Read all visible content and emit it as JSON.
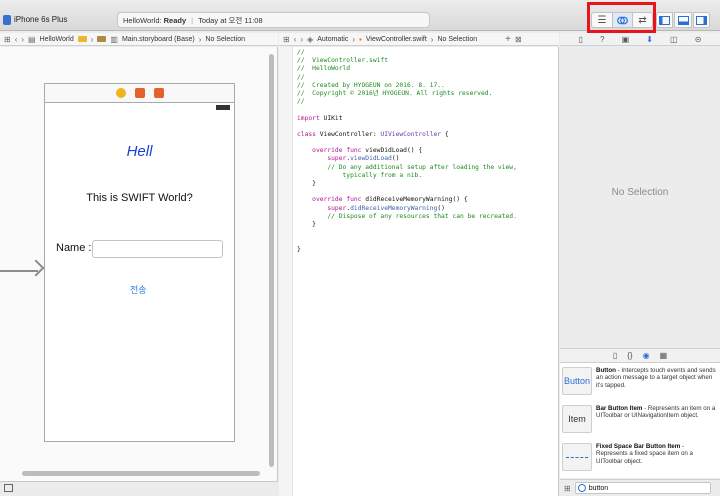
{
  "toolbar": {
    "scheme_device": "iPhone 6s Plus",
    "activity_project": "HelloWorld:",
    "activity_status": "Ready",
    "activity_time": "Today at 오전 11:08"
  },
  "ib_jumpbar": {
    "project": "HelloWorld",
    "file": "Main.storyboard (Base)",
    "selection": "No Selection"
  },
  "code_jumpbar": {
    "mode": "Automatic",
    "file": "ViewController.swift",
    "selection": "No Selection"
  },
  "scene": {
    "hell_label": "Hell",
    "title_label": "This is SWIFT World?",
    "name_label": "Name :",
    "send_button": "전송"
  },
  "code": {
    "lines": [
      "//",
      "//  ViewController.swift",
      "//  HelloWorld",
      "//",
      "//  Created by HYOGEUN on 2016. 8. 17..",
      "//  Copyright © 2016년 HYOGEUN. All rights reserved.",
      "//",
      "",
      "import UIKit",
      "",
      "class ViewController: UIViewController {",
      "",
      "    override func viewDidLoad() {",
      "        super.viewDidLoad()",
      "        // Do any additional setup after loading the view,",
      "            typically from a nib.",
      "    }",
      "",
      "    override func didReceiveMemoryWarning() {",
      "        super.didReceiveMemoryWarning()",
      "        // Dispose of any resources that can be recreated.",
      "    }",
      "",
      "",
      "}"
    ]
  },
  "inspector": {
    "empty_text": "No Selection"
  },
  "library": {
    "items": [
      {
        "icon_label": "Button",
        "title": "Button",
        "desc": " - Intercepts touch events and sends an action message to a target object when it's tapped."
      },
      {
        "icon_label": "Item",
        "title": "Bar Button Item",
        "desc": " - Represents an item on a UIToolbar or UINavigationItem object."
      },
      {
        "icon_label": "",
        "title": "Fixed Space Bar Button Item",
        "desc": " - Represents a fixed space item on a UIToolbar object."
      }
    ],
    "search_value": "button"
  },
  "colors": {
    "highlight": "#e8141b",
    "accent": "#2a6fd6",
    "comment": "#1e8a1e",
    "keyword": "#b0168c"
  }
}
